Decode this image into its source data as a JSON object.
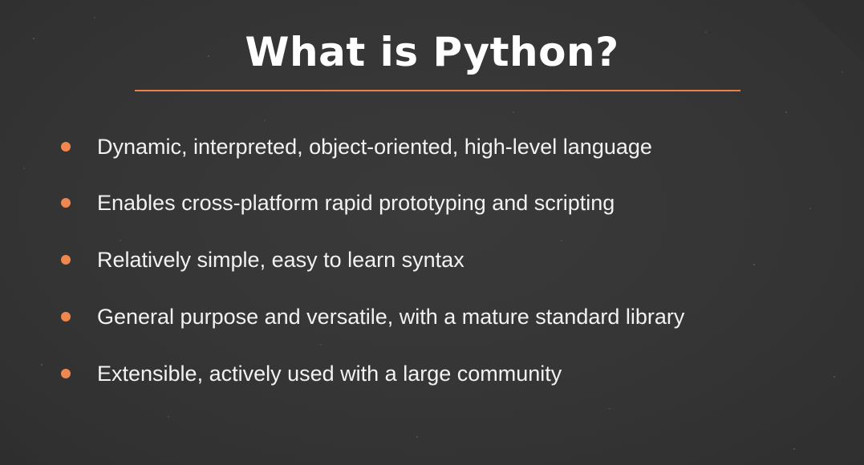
{
  "slide": {
    "title": "What is Python?",
    "accent_color": "#e8824a",
    "background_color": "#363636",
    "bullets": [
      "Dynamic, interpreted, object-oriented, high-level language",
      "Enables cross-platform rapid prototyping and scripting",
      "Relatively simple, easy to learn syntax",
      "General purpose and versatile, with a mature standard library",
      "Extensible, actively used with a large community"
    ]
  }
}
